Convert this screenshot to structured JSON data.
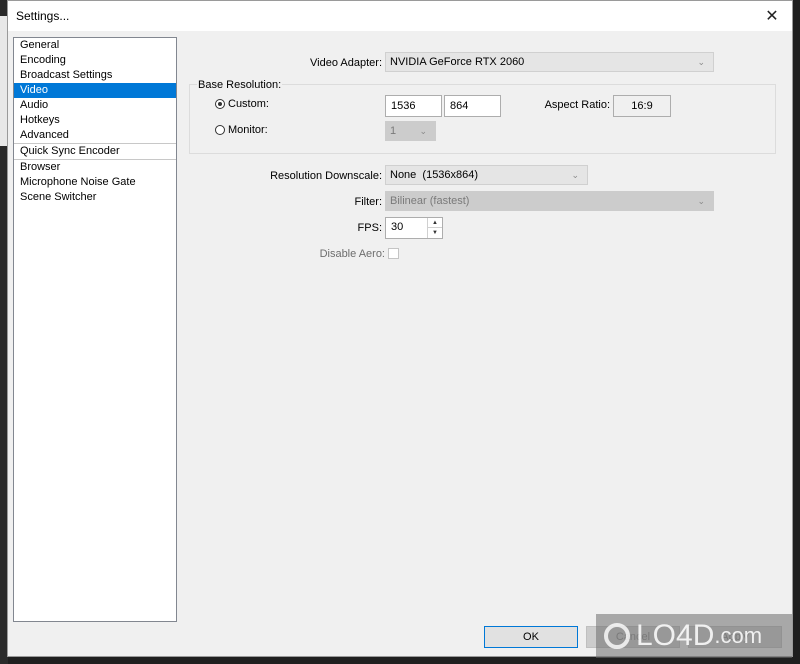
{
  "window": {
    "title": "Settings...",
    "close_glyph": "✕"
  },
  "nav": {
    "items": [
      {
        "label": "General",
        "selected": false
      },
      {
        "label": "Encoding",
        "selected": false
      },
      {
        "label": "Broadcast Settings",
        "selected": false
      },
      {
        "label": "Video",
        "selected": true
      },
      {
        "label": "Audio",
        "selected": false
      },
      {
        "label": "Hotkeys",
        "selected": false
      },
      {
        "label": "Advanced",
        "selected": false
      },
      {
        "label": "Quick Sync Encoder",
        "selected": false
      },
      {
        "label": "Browser",
        "selected": false
      },
      {
        "label": "Microphone Noise Gate",
        "selected": false
      },
      {
        "label": "Scene Switcher",
        "selected": false
      }
    ]
  },
  "video": {
    "adapter_label": "Video Adapter:",
    "adapter_value": "NVIDIA GeForce RTX 2060",
    "base_resolution_title": "Base Resolution:",
    "custom_label": "Custom:",
    "custom_selected": true,
    "width_value": "1536",
    "height_value": "864",
    "aspect_label": "Aspect Ratio:",
    "aspect_value": "16:9",
    "monitor_label": "Monitor:",
    "monitor_value": "1",
    "downscale_label": "Resolution Downscale:",
    "downscale_value": "None  (1536x864)",
    "filter_label": "Filter:",
    "filter_value": "Bilinear (fastest)",
    "fps_label": "FPS:",
    "fps_value": "30",
    "disable_aero_label": "Disable Aero:",
    "disable_aero_checked": false
  },
  "buttons": {
    "ok": "OK",
    "cancel": "Cancel",
    "apply": "Apply"
  },
  "icons": {
    "chevron": "⌄",
    "spin_up": "▲",
    "spin_down": "▼"
  },
  "watermark": {
    "text": "LO4D",
    "suffix": ".com"
  },
  "colors": {
    "selection": "#0078d7",
    "window_bg": "#f0f0f0"
  }
}
